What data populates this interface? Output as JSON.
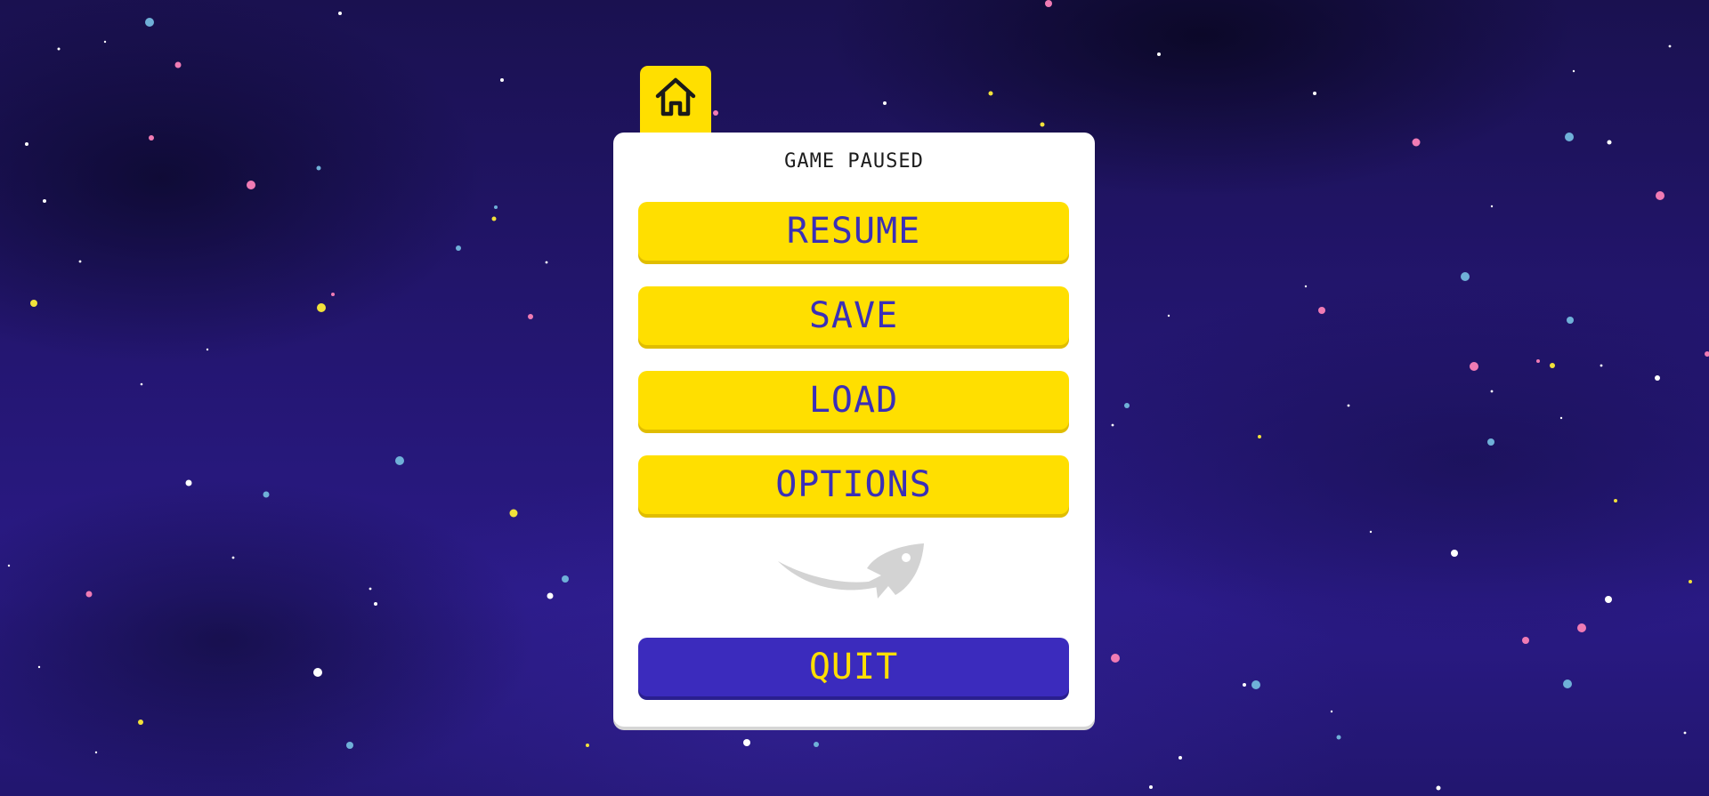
{
  "dialog": {
    "title": "GAME PAUSED"
  },
  "menu": {
    "resume_label": "RESUME",
    "save_label": "SAVE",
    "load_label": "LOAD",
    "options_label": "OPTIONS",
    "quit_label": "QUIT"
  },
  "icons": {
    "home_tab": "home-icon",
    "decoration": "rocket-icon"
  },
  "colors": {
    "accent_yellow": "#ffdf00",
    "accent_purple": "#3b2bbd",
    "button_text": "#3a2fb8",
    "panel": "#ffffff"
  }
}
